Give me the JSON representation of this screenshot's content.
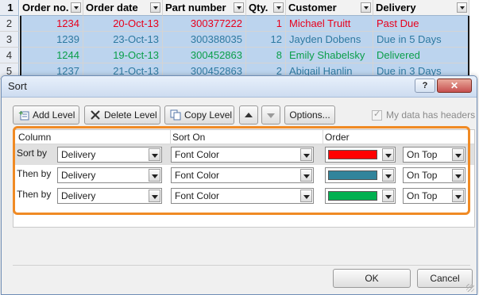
{
  "sheet": {
    "row_numbers": [
      "1",
      "2",
      "3",
      "4",
      "5"
    ],
    "headers": [
      "Order no.",
      "Order date",
      "Part number",
      "Qty.",
      "Customer",
      "Delivery"
    ],
    "rows": [
      {
        "order": "1234",
        "date": "20-Oct-13",
        "part": "300377222",
        "qty": "1",
        "customer": "Michael Truitt",
        "delivery": "Past Due",
        "color": "#e8001c"
      },
      {
        "order": "1239",
        "date": "23-Oct-13",
        "part": "300388035",
        "qty": "12",
        "customer": "Jayden Dobens",
        "delivery": "Due in 5 Days",
        "color": "#2e79a0"
      },
      {
        "order": "1244",
        "date": "19-Oct-13",
        "part": "300452863",
        "qty": "8",
        "customer": "Emily Shabelsky",
        "delivery": "Delivered",
        "color": "#0a9e4a"
      },
      {
        "order": "1237",
        "date": "21-Oct-13",
        "part": "300452863",
        "qty": "2",
        "customer": "Abigail Hanlin",
        "delivery": "Due in 3 Days",
        "color": "#2e79a0"
      }
    ]
  },
  "dialog": {
    "title": "Sort",
    "help_label": "?",
    "close_label": "✕",
    "add_level": "Add Level",
    "delete_level": "Delete Level",
    "copy_level": "Copy Level",
    "options": "Options...",
    "my_data_has_headers": "My data has headers",
    "col_column": "Column",
    "col_sort_on": "Sort On",
    "col_order": "Order",
    "levels": [
      {
        "label": "Sort by",
        "column": "Delivery",
        "sort_on": "Font Color",
        "color": "#ff0000",
        "position": "On Top"
      },
      {
        "label": "Then by",
        "column": "Delivery",
        "sort_on": "Font Color",
        "color": "#31849b",
        "position": "On Top"
      },
      {
        "label": "Then by",
        "column": "Delivery",
        "sort_on": "Font Color",
        "color": "#00b050",
        "position": "On Top"
      }
    ],
    "ok": "OK",
    "cancel": "Cancel",
    "accent_highlight": "#f08a24"
  }
}
